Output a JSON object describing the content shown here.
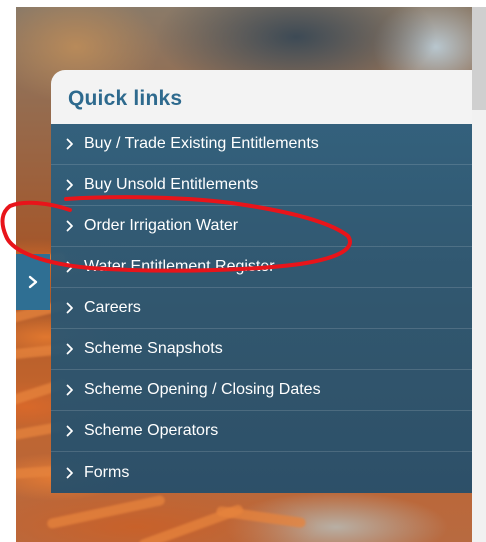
{
  "quick_links": {
    "title": "Quick links",
    "items": [
      {
        "label": "Buy / Trade Existing Entitlements"
      },
      {
        "label": "Buy Unsold Entitlements"
      },
      {
        "label": "Order Irrigation Water"
      },
      {
        "label": "Water Entitlement Register"
      },
      {
        "label": "Careers"
      },
      {
        "label": "Scheme Snapshots"
      },
      {
        "label": "Scheme Opening / Closing Dates"
      },
      {
        "label": "Scheme Operators"
      },
      {
        "label": "Forms"
      }
    ]
  },
  "side_toggle": {
    "icon": "chevron-right-icon"
  },
  "colors": {
    "title": "#2e6a8e",
    "panel": "#2c6080",
    "toggle": "#2f6f93",
    "annotation": "#e8141a"
  }
}
